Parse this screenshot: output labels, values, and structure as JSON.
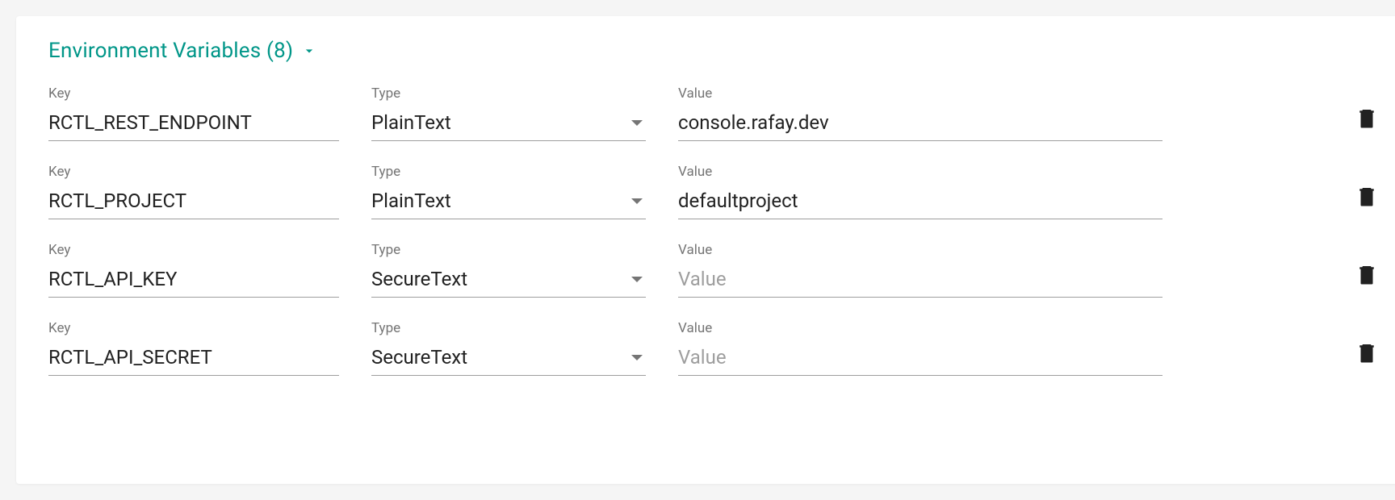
{
  "section": {
    "title": "Environment Variables (8)"
  },
  "labels": {
    "key": "Key",
    "type": "Type",
    "value": "Value",
    "valuePlaceholder": "Value"
  },
  "rows": [
    {
      "key": "RCTL_REST_ENDPOINT",
      "type": "PlainText",
      "value": "console.rafay.dev"
    },
    {
      "key": "RCTL_PROJECT",
      "type": "PlainText",
      "value": "defaultproject"
    },
    {
      "key": "RCTL_API_KEY",
      "type": "SecureText",
      "value": ""
    },
    {
      "key": "RCTL_API_SECRET",
      "type": "SecureText",
      "value": ""
    }
  ]
}
